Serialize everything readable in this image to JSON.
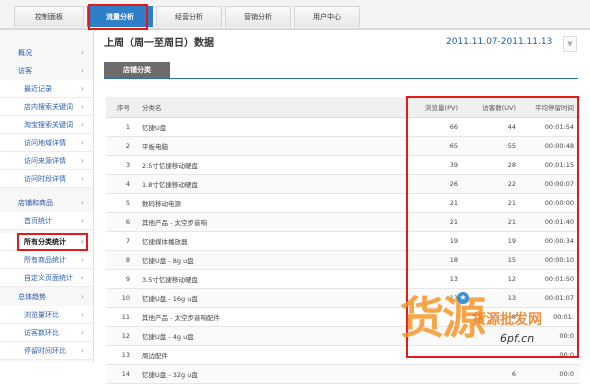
{
  "tabs": [
    "控制面板",
    "流量分析",
    "经营分析",
    "营销分析",
    "用户中心"
  ],
  "sidebar": {
    "items": [
      {
        "label": "概况",
        "type": "group"
      },
      {
        "label": "访客",
        "type": "group"
      },
      {
        "label": "最近记录",
        "type": "sub"
      },
      {
        "label": "店内搜索关键词",
        "type": "sub"
      },
      {
        "label": "淘宝搜索关键词",
        "type": "sub"
      },
      {
        "label": "访问地域详情",
        "type": "sub"
      },
      {
        "label": "访问来源详情",
        "type": "sub"
      },
      {
        "label": "访问时段详情",
        "type": "sub"
      },
      {
        "label": "店铺和商品",
        "type": "group"
      },
      {
        "label": "首页统计",
        "type": "sub"
      },
      {
        "label": "所有分类统计",
        "type": "sub",
        "selected": true
      },
      {
        "label": "所有商品统计",
        "type": "sub"
      },
      {
        "label": "自定义页面统计",
        "type": "sub"
      },
      {
        "label": "总体趋势",
        "type": "group"
      },
      {
        "label": "浏览量环比",
        "type": "sub"
      },
      {
        "label": "访客数环比",
        "type": "sub"
      },
      {
        "label": "停留时间环比",
        "type": "sub"
      }
    ]
  },
  "main": {
    "title": "上周（周一至周日）数据",
    "date_range": "2011.11.07-2011.11.13",
    "subtab": "店铺分类"
  },
  "table": {
    "headers": [
      "序号",
      "分类名",
      "浏览量(PV)",
      "访客数(UV)",
      "平均停留时间"
    ],
    "rows": [
      [
        "1",
        "忆捷U盘",
        "66",
        "44",
        "00:01:54"
      ],
      [
        "2",
        "平板电脑",
        "65",
        "55",
        "00:00:48"
      ],
      [
        "3",
        "2.5寸忆捷移动硬盘",
        "39",
        "28",
        "00:01:15"
      ],
      [
        "4",
        "1.8寸忆捷移动硬盘",
        "26",
        "22",
        "00:00:07"
      ],
      [
        "5",
        "数码移动电源",
        "21",
        "21",
        "00:00:00"
      ],
      [
        "6",
        "其他产品 - 太空步音响",
        "21",
        "21",
        "00:01:40"
      ],
      [
        "7",
        "忆捷媒体播放器",
        "19",
        "19",
        "00:00:34"
      ],
      [
        "8",
        "忆捷U盘 - 8g u盘",
        "18",
        "15",
        "00:00:10"
      ],
      [
        "9",
        "3.5寸忆捷移动硬盘",
        "13",
        "12",
        "00:01:50"
      ],
      [
        "10",
        "忆捷U盘 - 16g u盘",
        "13",
        "13",
        "00:01:07"
      ],
      [
        "11",
        "其他产品 - 太空步音响配件",
        "",
        "8",
        "00:01:"
      ],
      [
        "12",
        "忆捷U盘 - 4g u盘",
        "",
        "",
        "00:0"
      ],
      [
        "13",
        "周边配件",
        "",
        "",
        "00:0"
      ],
      [
        "14",
        "忆捷U盘 - 32g u盘",
        "",
        "6",
        "00:0"
      ]
    ]
  },
  "watermark": {
    "big": "货源",
    "line": "货源批发网",
    "url": "6pf.cn"
  },
  "colors": {
    "highlight": "#e41a1a",
    "active_tab": "#2f7fc8",
    "link": "#2255aa"
  }
}
